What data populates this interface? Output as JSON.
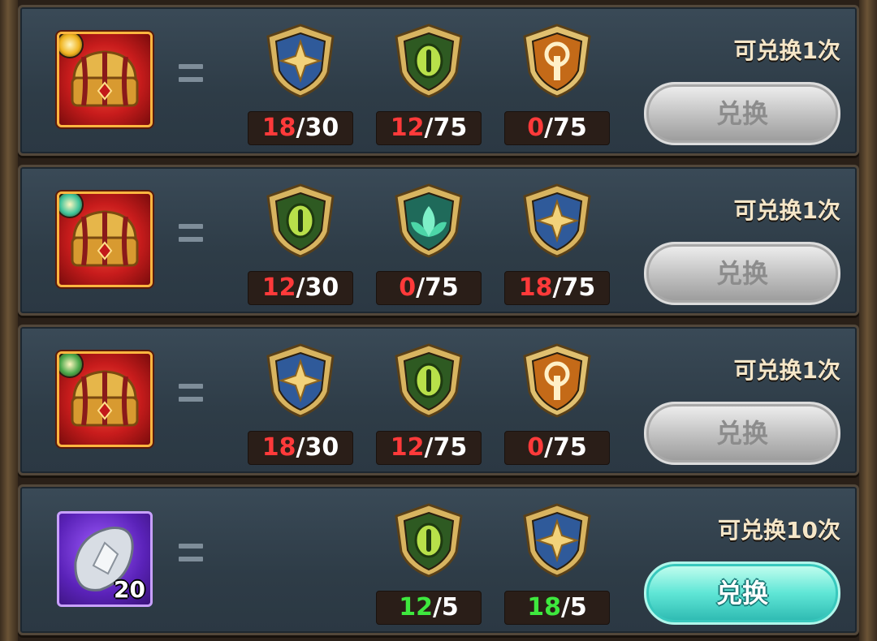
{
  "rows": [
    {
      "reward": "chest",
      "badge_color": "#f0b420",
      "items": [
        {
          "icon": "star-blue-emblem",
          "have": "18",
          "need": "30",
          "status": "red"
        },
        {
          "icon": "eye-green-emblem",
          "have": "12",
          "need": "75",
          "status": "red"
        },
        {
          "icon": "sword-orange-emblem",
          "have": "0",
          "need": "75",
          "status": "red"
        }
      ],
      "limit_text": "可兑换1次",
      "button_label": "兑换",
      "button_state": "disabled"
    },
    {
      "reward": "chest",
      "badge_color": "#3fc49a",
      "items": [
        {
          "icon": "eye-green-emblem",
          "have": "12",
          "need": "30",
          "status": "red"
        },
        {
          "icon": "lotus-teal-emblem",
          "have": "0",
          "need": "75",
          "status": "red"
        },
        {
          "icon": "star-blue-emblem",
          "have": "18",
          "need": "75",
          "status": "red"
        }
      ],
      "limit_text": "可兑换1次",
      "button_label": "兑换",
      "button_state": "disabled"
    },
    {
      "reward": "chest",
      "badge_color": "#4aa84a",
      "items": [
        {
          "icon": "star-blue-emblem",
          "have": "18",
          "need": "30",
          "status": "red"
        },
        {
          "icon": "eye-green-emblem",
          "have": "12",
          "need": "75",
          "status": "red"
        },
        {
          "icon": "sword-orange-emblem",
          "have": "0",
          "need": "75",
          "status": "red"
        }
      ],
      "limit_text": "可兑换1次",
      "button_label": "兑换",
      "button_state": "disabled"
    },
    {
      "reward": "gem",
      "reward_count": "20",
      "items": [
        {
          "icon": "eye-green-emblem",
          "have": "12",
          "need": "5",
          "status": "green"
        },
        {
          "icon": "star-blue-emblem",
          "have": "18",
          "need": "5",
          "status": "green"
        }
      ],
      "limit_text": "可兑换10次",
      "button_label": "兑换",
      "button_state": "active"
    }
  ]
}
